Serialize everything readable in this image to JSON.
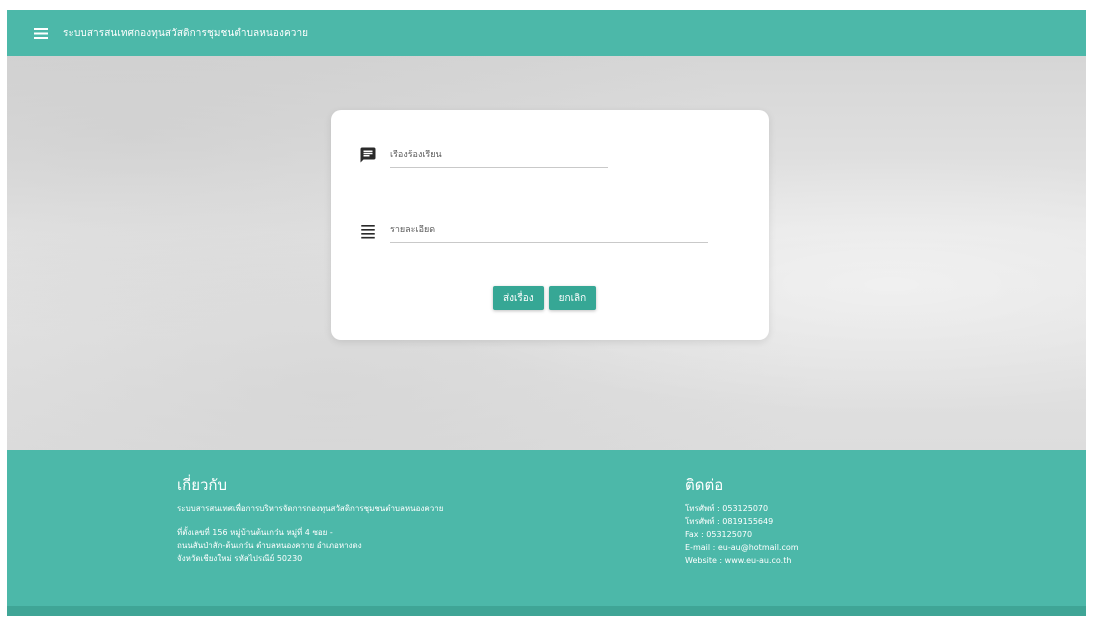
{
  "header": {
    "title": "ระบบสารสนเทศกองทุนสวัสดิการชุมชนตำบลหนองควาย"
  },
  "form": {
    "subject_placeholder": "เรื่องร้องเรียน",
    "detail_placeholder": "รายละเอียด",
    "submit_label": "ส่งเรื่อง",
    "cancel_label": "ยกเลิก"
  },
  "footer": {
    "about": {
      "heading": "เกี่ยวกับ",
      "description": "ระบบสารสนเทศเพื่อการบริหารจัดการกองทุนสวัสดิการชุมชนตำบลหนองควาย",
      "address_lines": [
        "ที่ตั้งเลขที่ 156 หมู่บ้านต้นเกว๋น หมู่ที่ 4 ซอย -",
        "ถนนสันป่าสัก-ต้นเกว๋น ตำบลหนองควาย อำเภอหางดง",
        "จังหวัดเชียงใหม่ รหัสไปรณีย์ 50230"
      ]
    },
    "contact": {
      "heading": "ติดต่อ",
      "lines": [
        "โทรศัพท์ : 053125070",
        "โทรศัพท์ : 0819155649",
        "Fax : 053125070",
        "E-mail : eu-au@hotmail.com",
        "Website : www.eu-au.co.th"
      ]
    }
  },
  "icons": {
    "menu": "hamburger-menu-icon",
    "subject": "chat-bubble-icon",
    "detail": "text-lines-icon"
  },
  "colors": {
    "primary": "#4cb8a9",
    "button": "#36a795",
    "footer_bottom": "#3fa596"
  }
}
